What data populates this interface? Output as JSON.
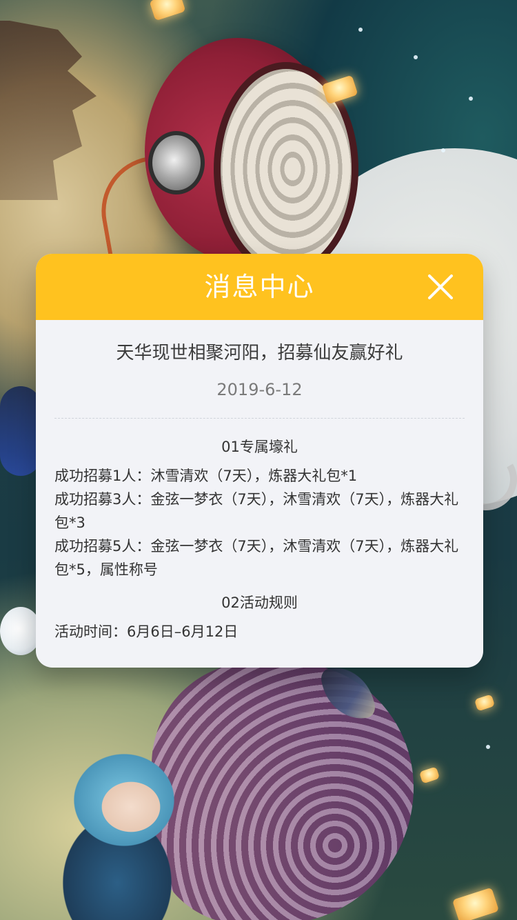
{
  "modal": {
    "title": "消息中心",
    "message_title": "天华现世相聚河阳，招募仙友赢好礼",
    "message_date": "2019-6-12",
    "section1_title": "01专属壕礼",
    "section1_lines": [
      "成功招募1人：沐雪清欢（7天），炼器大礼包*1",
      "成功招募3人：金弦一梦衣（7天），沐雪清欢（7天），炼器大礼包*3",
      "成功招募5人：金弦一梦衣（7天），沐雪清欢（7天），炼器大礼包*5，属性称号"
    ],
    "section2_title": "02活动规则",
    "section2_lines": [
      "活动时间：6月6日–6月12日"
    ]
  },
  "colors": {
    "header": "#ffc21f",
    "panel": "#f2f3f7",
    "text": "#333333",
    "date": "#7a7a7a"
  },
  "icons": {
    "close": "close-icon"
  }
}
